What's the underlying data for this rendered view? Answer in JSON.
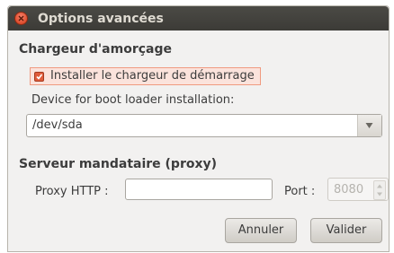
{
  "window": {
    "title": "Options avancées"
  },
  "bootloader": {
    "section_title": "Chargeur d'amorçage",
    "install_checkbox_label": "Installer le chargeur de démarrage",
    "install_checked": true,
    "device_label": "Device for boot loader installation:",
    "device_value": "/dev/sda"
  },
  "proxy": {
    "section_title": "Serveur mandataire (proxy)",
    "http_label": "Proxy HTTP :",
    "http_value": "",
    "port_label": "Port :",
    "port_value": "8080"
  },
  "buttons": {
    "cancel": "Annuler",
    "ok": "Valider"
  },
  "colors": {
    "accent": "#e05c3b",
    "titlebar": "#3c3b37",
    "window_bg": "#f2f1f0"
  }
}
